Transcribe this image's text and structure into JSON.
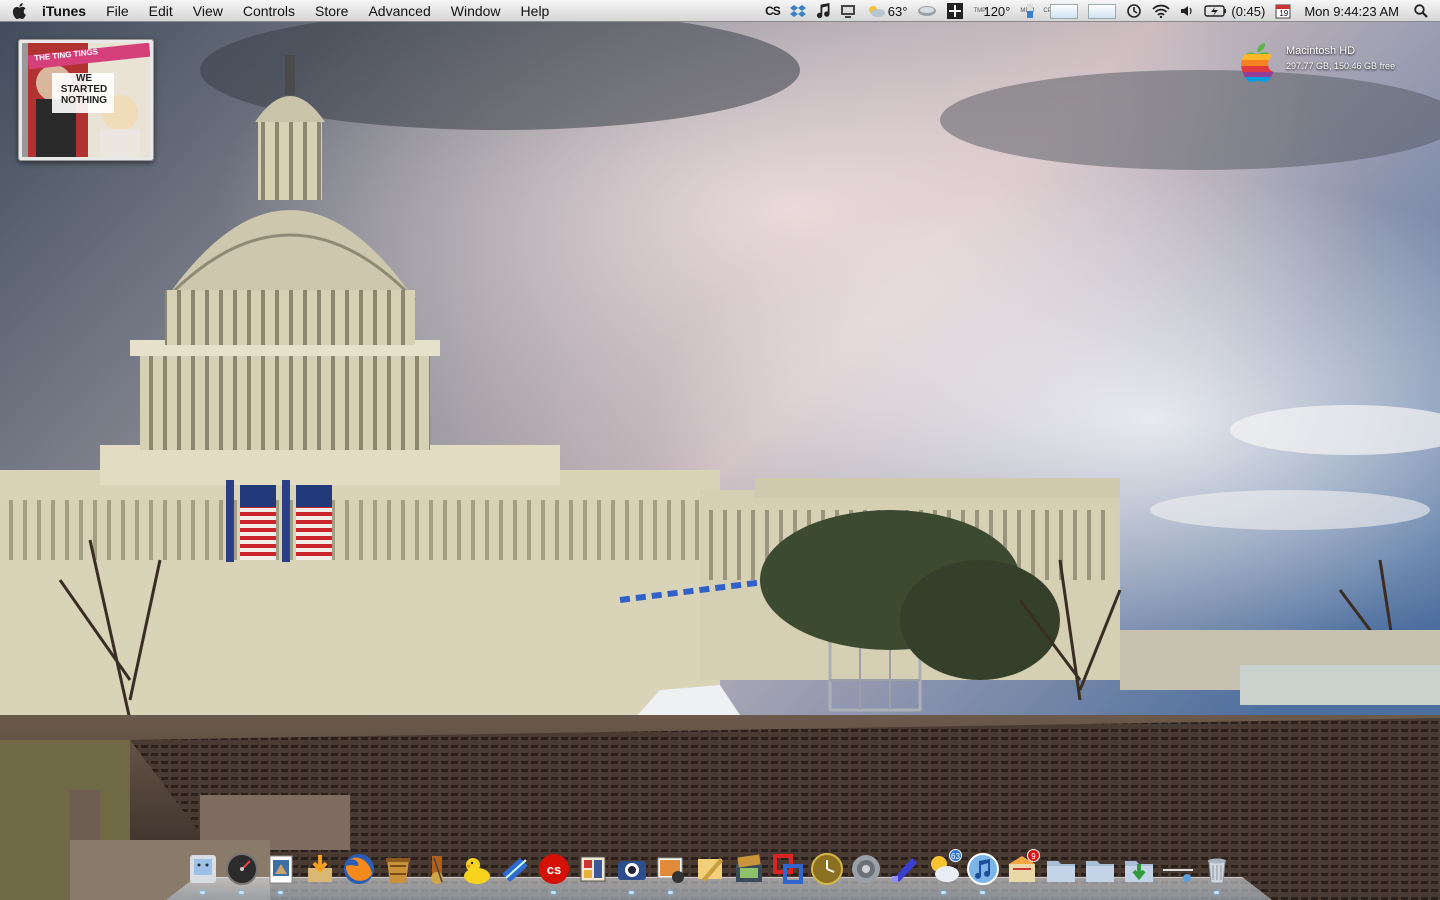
{
  "menubar": {
    "app_name": "iTunes",
    "menus": [
      "File",
      "Edit",
      "View",
      "Controls",
      "Store",
      "Advanced",
      "Window",
      "Help"
    ],
    "cs_label": "CS",
    "weather_temp": "63°",
    "temp_reading": "120°",
    "temp_label": "TMP",
    "mem_label": "MEM",
    "cpu_label": "CPU",
    "battery_time": "(0:45)",
    "calendar_day": "19",
    "clock": "Mon 9:44:23 AM"
  },
  "desktop": {
    "drive_name": "Macintosh HD",
    "drive_info": "297.77 GB, 150.46 GB free"
  },
  "album": {
    "band_name": "THE TING TINGS",
    "album_title": "WE STARTED NOTHING"
  },
  "dock": {
    "items": [
      {
        "name": "finder",
        "icon": "finder-icon"
      },
      {
        "name": "dashboard",
        "icon": "dashboard-icon"
      },
      {
        "name": "preview",
        "icon": "preview-icon"
      },
      {
        "name": "downloads-app",
        "icon": "downloads-icon"
      },
      {
        "name": "firefox",
        "icon": "firefox-icon"
      },
      {
        "name": "stuff",
        "icon": "bucket-icon"
      },
      {
        "name": "instruments",
        "icon": "instruments-icon"
      },
      {
        "name": "cyberduck",
        "icon": "duck-icon"
      },
      {
        "name": "xcode",
        "icon": "xcode-icon"
      },
      {
        "name": "lastfm",
        "icon": "lastfm-icon"
      },
      {
        "name": "comic",
        "icon": "comic-icon"
      },
      {
        "name": "camera",
        "icon": "camera-icon"
      },
      {
        "name": "iphoto",
        "icon": "iphoto-icon"
      },
      {
        "name": "pencil",
        "icon": "pencil-icon"
      },
      {
        "name": "imovie",
        "icon": "film-icon"
      },
      {
        "name": "parallels",
        "icon": "parallels-icon"
      },
      {
        "name": "clock",
        "icon": "clock-icon"
      },
      {
        "name": "system-preferences",
        "icon": "gear-icon"
      },
      {
        "name": "ftp",
        "icon": "ftp-icon"
      },
      {
        "name": "weather",
        "icon": "weather-icon",
        "badge": "63"
      },
      {
        "name": "itunes",
        "icon": "itunes-icon"
      },
      {
        "name": "mail-box",
        "icon": "inbox-icon",
        "badge": "9"
      },
      {
        "name": "folder-a",
        "icon": "folder-icon"
      },
      {
        "name": "folder-b",
        "icon": "folder-icon"
      },
      {
        "name": "downloads-stack",
        "icon": "download-arrow-icon"
      },
      {
        "name": "separator",
        "icon": "dock-separator-icon"
      },
      {
        "name": "trash",
        "icon": "trash-icon"
      }
    ]
  }
}
